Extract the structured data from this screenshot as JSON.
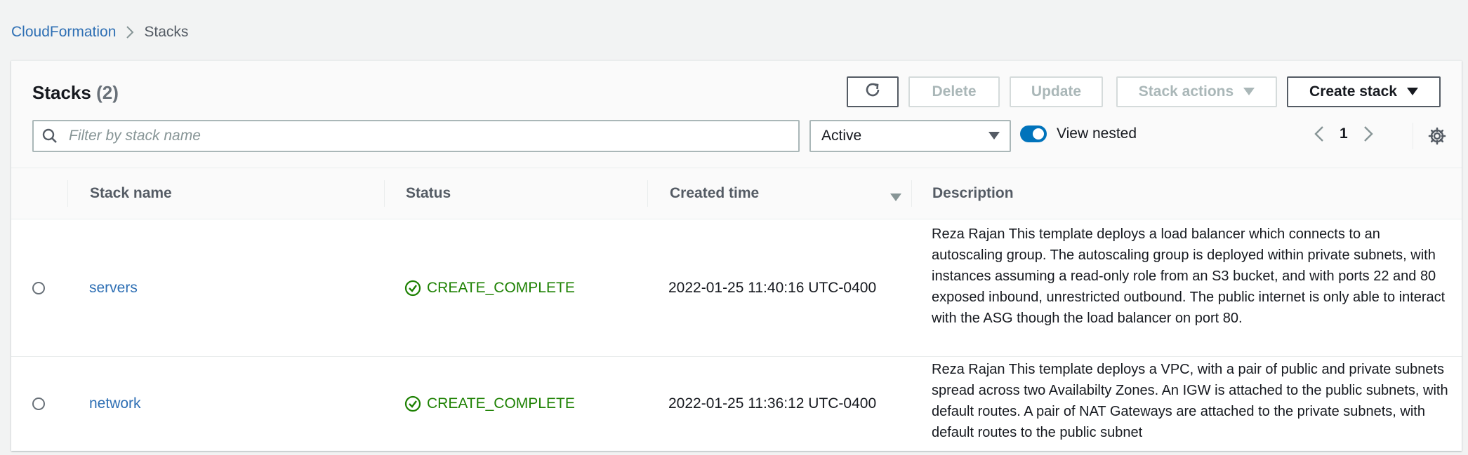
{
  "breadcrumb": {
    "root": "CloudFormation",
    "current": "Stacks"
  },
  "header": {
    "title": "Stacks",
    "count": "(2)",
    "buttons": {
      "delete": "Delete",
      "update": "Update",
      "stack_actions": "Stack actions",
      "create_stack": "Create stack"
    }
  },
  "filter": {
    "placeholder": "Filter by stack name",
    "status_value": "Active",
    "view_nested_label": "View nested",
    "view_nested_on": true,
    "page": "1"
  },
  "table": {
    "columns": {
      "name": "Stack name",
      "status": "Status",
      "created": "Created time",
      "description": "Description"
    },
    "rows": [
      {
        "name": "servers",
        "status": "CREATE_COMPLETE",
        "created": "2022-01-25 11:40:16 UTC-0400",
        "description": "Reza Rajan This template deploys a load balancer which connects to an autoscaling group. The autoscaling group is deployed within private subnets, with instances assuming a read-only role from an S3 bucket, and with ports 22 and 80 exposed inbound, unrestricted outbound. The public internet is only able to interact with the ASG though the load balancer on port 80."
      },
      {
        "name": "network",
        "status": "CREATE_COMPLETE",
        "created": "2022-01-25 11:36:12 UTC-0400",
        "description": "Reza Rajan This template deploys a VPC, with a pair of public and private subnets spread across two Availabilty Zones. An IGW is attached to the public subnets, with default routes. A pair of NAT Gateways are attached to the private subnets, with default routes to the public subnet"
      }
    ]
  },
  "colors": {
    "link": "#2e6fb4",
    "success": "#1d8102",
    "toggle": "#0073bb"
  }
}
